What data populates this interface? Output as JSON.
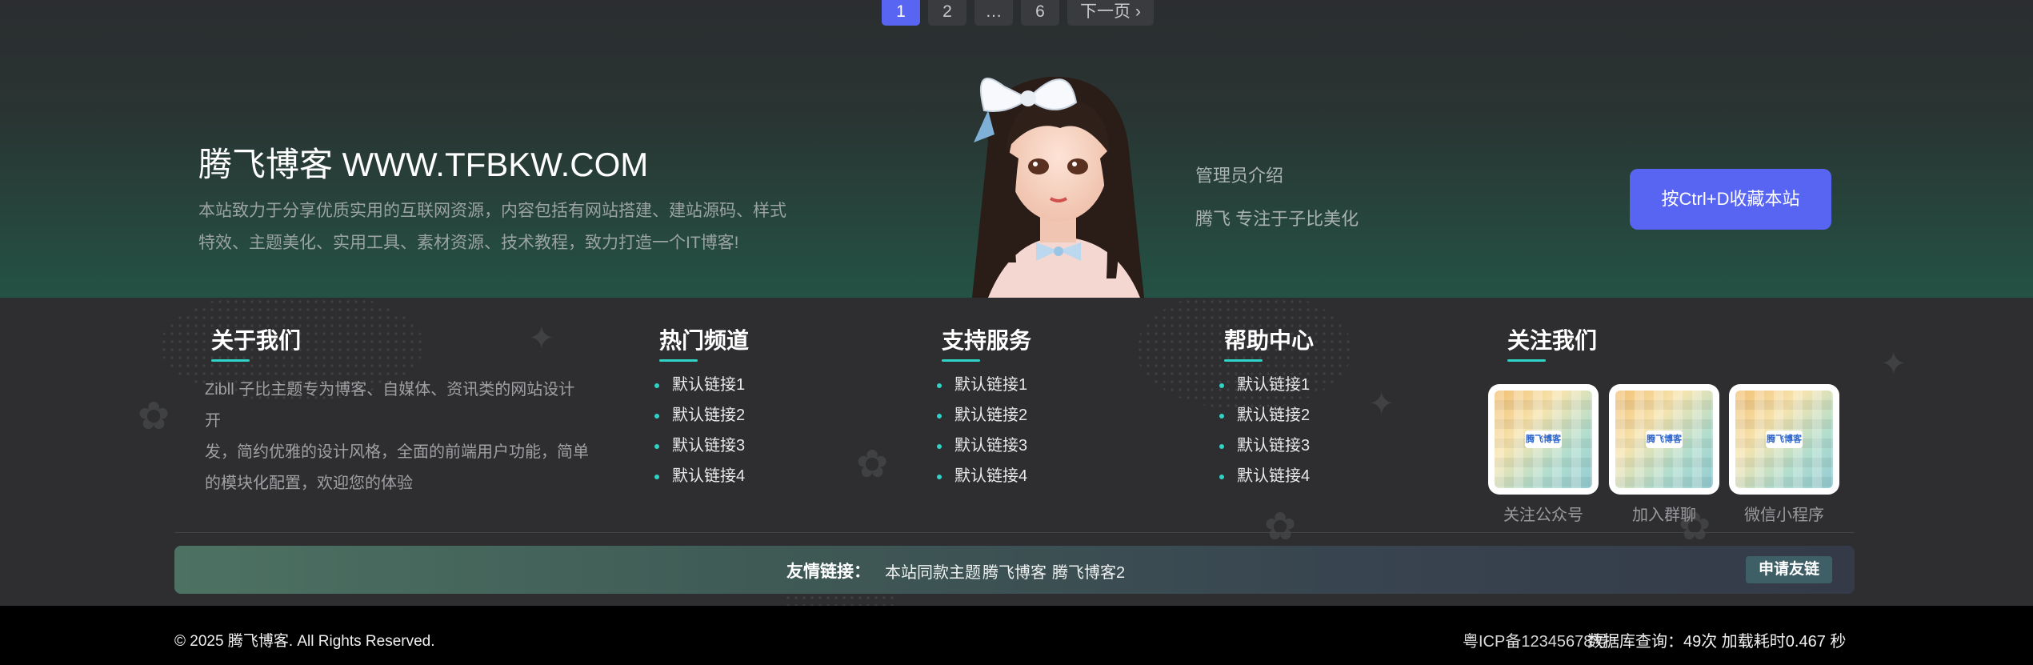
{
  "pagination": {
    "pages": [
      "1",
      "2",
      "…",
      "6"
    ],
    "next_label": "下一页 ›",
    "current": "1"
  },
  "brand": {
    "title": "腾飞博客 WWW.TFBKW.COM",
    "description_line1": "本站致力于分享优质实用的互联网资源，内容包括有网站搭建、建站源码、样式",
    "description_line2": "特效、主题美化、实用工具、素材资源、技术教程，致力打造一个IT博客!"
  },
  "admin": {
    "title": "管理员介绍",
    "description": "腾飞 专注于子比美化"
  },
  "bookmark_button": "按Ctrl+D收藏本站",
  "columns": {
    "about": {
      "title": "关于我们",
      "text_line1": "Zibll 子比主题专为博客、自媒体、资讯类的网站设计开",
      "text_line2": "发，简约优雅的设计风格，全面的前端用户功能，简单",
      "text_line3": "的模块化配置，欢迎您的体验"
    },
    "hot": {
      "title": "热门频道",
      "links": [
        "默认链接1",
        "默认链接2",
        "默认链接3",
        "默认链接4"
      ]
    },
    "support": {
      "title": "支持服务",
      "links": [
        "默认链接1",
        "默认链接2",
        "默认链接3",
        "默认链接4"
      ]
    },
    "help": {
      "title": "帮助中心",
      "links": [
        "默认链接1",
        "默认链接2",
        "默认链接3",
        "默认链接4"
      ]
    },
    "follow": {
      "title": "关注我们",
      "qrcodes": [
        {
          "label": "关注公众号",
          "logo": "腾飞博客"
        },
        {
          "label": "加入群聊",
          "logo": "腾飞博客"
        },
        {
          "label": "微信小程序",
          "logo": "腾飞博客"
        }
      ]
    }
  },
  "friend_links": {
    "label": "友情链接：",
    "links": [
      "本站同款主题",
      "腾飞博客",
      "腾飞博客2"
    ],
    "apply_button": "申请友链"
  },
  "footer": {
    "copyright": "© 2025 腾飞博客. All Rights Reserved.",
    "icp": "粤ICP备12345678号",
    "stats": "数据库查询：49次 加载耗时0.467 秒"
  },
  "colors": {
    "accent": "#5865f2",
    "teal": "#2ed3c6",
    "footer_bg": "#000000"
  }
}
